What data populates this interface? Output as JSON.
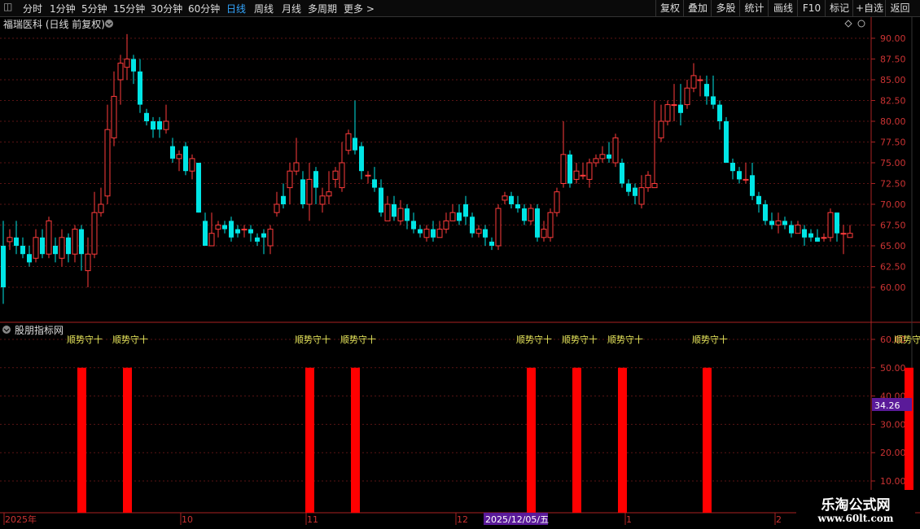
{
  "toolbar": {
    "left_items": [
      "分时",
      "1分钟",
      "5分钟",
      "15分钟",
      "30分钟",
      "60分钟",
      "日线",
      "周线",
      "月线",
      "多周期",
      "更多 >"
    ],
    "active": "日线",
    "right_items": [
      "复权",
      "叠加",
      "多股",
      "统计",
      "画线",
      "F10",
      "标记",
      "+自选",
      "返回"
    ]
  },
  "main_panel": {
    "title": "福瑞医科 (日线 前复权)",
    "y_ticks": [
      "90.00",
      "87.50",
      "85.00",
      "82.50",
      "80.00",
      "77.50",
      "75.00",
      "72.50",
      "70.00",
      "67.50",
      "65.00",
      "62.50",
      "60.00"
    ]
  },
  "indicator_panel": {
    "title": "股朋指标网",
    "y_ticks": [
      "60.00",
      "50.00",
      "40.00",
      "30.00",
      "20.00",
      "10.00"
    ],
    "value_box": "34.26",
    "signal_label": "顺势守十"
  },
  "date_axis": {
    "labels": [
      "2025年",
      "10",
      "11",
      "12",
      "1",
      "2"
    ],
    "cursor": "2025/12/05/五"
  },
  "watermark": {
    "line1": "乐淘公式网",
    "line2": "www.60lt.com"
  },
  "colors": {
    "up": "#ff3b3b",
    "down": "#00e5e5",
    "signal": "#ff0000",
    "signal_text": "#e8e85c",
    "axis": "#aa2222",
    "box": "#5a1a99"
  },
  "chart_data": [
    {
      "type": "candlestick",
      "title": "福瑞医科 (日线 前复权)",
      "ylim": [
        57.5,
        91.5
      ],
      "y_ticks": [
        90,
        87.5,
        85,
        82.5,
        80,
        77.5,
        75,
        72.5,
        70,
        67.5,
        65,
        62.5,
        60
      ],
      "candles": [
        [
          65,
          60,
          68,
          58
        ],
        [
          65.5,
          66,
          67,
          64.5
        ],
        [
          66,
          65,
          68,
          64
        ],
        [
          65,
          64,
          66,
          63.5
        ],
        [
          64,
          63,
          65,
          62.5
        ],
        [
          63.5,
          66,
          67,
          63
        ],
        [
          66,
          64,
          67,
          63.5
        ],
        [
          64,
          68,
          68.5,
          63.5
        ],
        [
          65,
          64,
          66,
          63
        ],
        [
          63.5,
          66,
          67,
          62.5
        ],
        [
          66,
          64,
          66.5,
          63
        ],
        [
          64,
          67,
          67.5,
          63
        ],
        [
          67,
          64,
          67.5,
          62
        ],
        [
          62,
          64,
          66,
          60
        ],
        [
          64,
          69,
          71.5,
          63.5
        ],
        [
          69,
          70,
          72,
          68.5
        ],
        [
          71,
          79,
          82,
          70
        ],
        [
          78,
          83,
          86,
          77
        ],
        [
          85,
          87,
          88,
          82
        ],
        [
          86.5,
          87.5,
          90.5,
          85
        ],
        [
          87.5,
          86,
          88,
          84.5
        ],
        [
          86,
          82,
          87.5,
          81
        ],
        [
          81,
          80,
          81.5,
          79.5
        ],
        [
          80,
          79,
          80.5,
          78
        ],
        [
          80,
          79,
          80.5,
          78
        ],
        [
          79,
          80,
          82,
          78.5
        ],
        [
          77,
          75.5,
          78,
          75
        ],
        [
          75.5,
          76,
          76.5,
          74
        ],
        [
          77,
          74,
          77.5,
          73.5
        ],
        [
          74,
          75.5,
          76,
          73
        ],
        [
          75,
          69,
          75,
          69
        ],
        [
          68,
          65,
          69,
          65
        ],
        [
          65,
          66.5,
          69,
          65
        ],
        [
          67,
          67.5,
          68,
          66
        ],
        [
          67.5,
          67,
          68,
          66.5
        ],
        [
          68,
          66,
          68.5,
          65.5
        ],
        [
          67,
          66.5,
          67.5,
          66
        ],
        [
          67,
          67,
          67.5,
          66
        ],
        [
          67,
          66.5,
          67.5,
          65.5
        ],
        [
          66,
          65.5,
          66.5,
          65
        ],
        [
          66.5,
          66,
          67,
          64
        ],
        [
          65,
          67,
          67.5,
          64
        ],
        [
          69,
          70,
          71.5,
          68.5
        ],
        [
          71,
          70,
          72.5,
          69.5
        ],
        [
          72,
          74,
          75,
          70
        ],
        [
          74,
          75,
          78,
          73.5
        ],
        [
          73,
          70,
          74,
          69.5
        ],
        [
          70,
          73,
          75,
          68
        ],
        [
          74,
          72,
          74.5,
          70
        ],
        [
          70,
          71,
          72,
          69
        ],
        [
          71,
          71.5,
          74,
          70
        ],
        [
          73,
          74,
          74.5,
          72
        ],
        [
          72,
          75,
          77.5,
          71.5
        ],
        [
          76.5,
          78.5,
          79,
          76
        ],
        [
          78,
          76.5,
          82.5,
          76
        ],
        [
          77,
          74,
          77.5,
          73
        ],
        [
          73.5,
          73.5,
          74,
          72.5
        ],
        [
          73,
          72,
          74.5,
          71.5
        ],
        [
          72,
          69,
          73,
          68.5
        ],
        [
          68,
          70,
          71,
          68
        ],
        [
          70,
          68.5,
          71,
          68
        ],
        [
          68,
          69.5,
          70.5,
          67.5
        ],
        [
          69.5,
          68,
          70,
          67
        ],
        [
          68,
          67,
          69,
          66.5
        ],
        [
          67,
          66.5,
          67.5,
          66
        ],
        [
          66,
          67,
          67.5,
          65.5
        ],
        [
          67,
          66,
          68,
          65.5
        ],
        [
          66,
          67,
          68,
          66
        ],
        [
          67,
          68,
          69,
          66.5
        ],
        [
          68,
          69,
          70,
          68
        ],
        [
          69,
          68,
          70,
          67.5
        ],
        [
          70,
          68.5,
          71,
          67.5
        ],
        [
          68.5,
          66.5,
          69,
          66
        ],
        [
          66.5,
          67,
          67.5,
          66
        ],
        [
          67,
          66,
          67.5,
          65
        ],
        [
          65.5,
          65,
          66,
          64.5
        ],
        [
          65,
          69.5,
          70,
          64.5
        ],
        [
          70.5,
          71,
          71.5,
          70
        ],
        [
          71,
          70,
          71.5,
          69.5
        ],
        [
          70,
          69.5,
          71,
          69
        ],
        [
          69.5,
          68,
          70,
          67.5
        ],
        [
          68,
          69.5,
          70,
          67.5
        ],
        [
          69.5,
          66,
          70,
          65.5
        ],
        [
          66,
          67,
          68,
          65.5
        ],
        [
          66,
          69,
          69.5,
          65.5
        ],
        [
          69,
          71.5,
          72,
          68.5
        ],
        [
          72.5,
          76,
          80,
          72
        ],
        [
          76,
          72.5,
          76.5,
          72
        ],
        [
          73,
          74,
          75,
          72.5
        ],
        [
          73.5,
          73.5,
          75,
          73
        ],
        [
          73,
          75,
          75.5,
          72
        ],
        [
          75,
          75.5,
          76,
          74.5
        ],
        [
          75.5,
          76,
          77,
          75
        ],
        [
          76,
          75.5,
          77.5,
          75
        ],
        [
          75,
          78,
          78.5,
          74.5
        ],
        [
          75,
          72.5,
          75.5,
          72
        ],
        [
          72.5,
          71.5,
          73,
          71
        ],
        [
          72,
          71,
          72.5,
          70
        ],
        [
          70,
          72,
          73.5,
          69.5
        ],
        [
          72,
          73.5,
          74,
          71.5
        ],
        [
          72,
          72.5,
          82.5,
          72
        ],
        [
          78,
          80,
          82,
          77.5
        ],
        [
          80,
          82,
          82.5,
          79.5
        ],
        [
          82,
          82,
          84.5,
          80
        ],
        [
          82,
          81,
          84.5,
          79.5
        ],
        [
          82,
          84,
          85,
          81.5
        ],
        [
          84,
          85.5,
          87,
          83.5
        ],
        [
          85,
          85,
          85.5,
          83
        ],
        [
          84.5,
          83,
          85.5,
          82
        ],
        [
          83,
          82,
          85.5,
          81.5
        ],
        [
          82,
          80,
          82.5,
          79
        ],
        [
          80,
          75,
          80.5,
          75
        ],
        [
          75,
          74,
          75.5,
          73
        ],
        [
          74,
          73,
          74.5,
          72.5
        ],
        [
          73,
          73,
          75,
          72.5
        ],
        [
          73.5,
          71,
          75,
          70.5
        ],
        [
          71,
          70,
          71.5,
          69
        ],
        [
          70,
          68,
          70.5,
          67.5
        ],
        [
          68,
          67.5,
          69,
          67
        ],
        [
          67.5,
          68,
          69,
          66.5
        ],
        [
          68,
          67.5,
          68.5,
          67
        ],
        [
          67.5,
          66.5,
          68,
          66
        ],
        [
          66.5,
          67.5,
          68,
          66.5
        ],
        [
          67,
          66,
          67.5,
          65
        ],
        [
          66.5,
          66,
          67,
          65.5
        ],
        [
          66,
          65.5,
          67,
          65.5
        ],
        [
          66,
          66,
          66.5,
          65.5
        ],
        [
          66,
          69,
          69.5,
          65.5
        ],
        [
          69,
          66.5,
          69,
          65.5
        ],
        [
          66.5,
          66.5,
          67.5,
          64
        ],
        [
          66,
          66.5,
          67.5,
          66
        ]
      ]
    },
    {
      "type": "bar",
      "title": "股朋指标网",
      "ylim": [
        0,
        64
      ],
      "y_ticks": [
        60,
        50,
        40,
        30,
        20,
        10
      ],
      "signal_indices": [
        12,
        19,
        47,
        54,
        81,
        88,
        95,
        108,
        139
      ],
      "signal_value": 50,
      "signal_label": "顺势守十"
    }
  ]
}
